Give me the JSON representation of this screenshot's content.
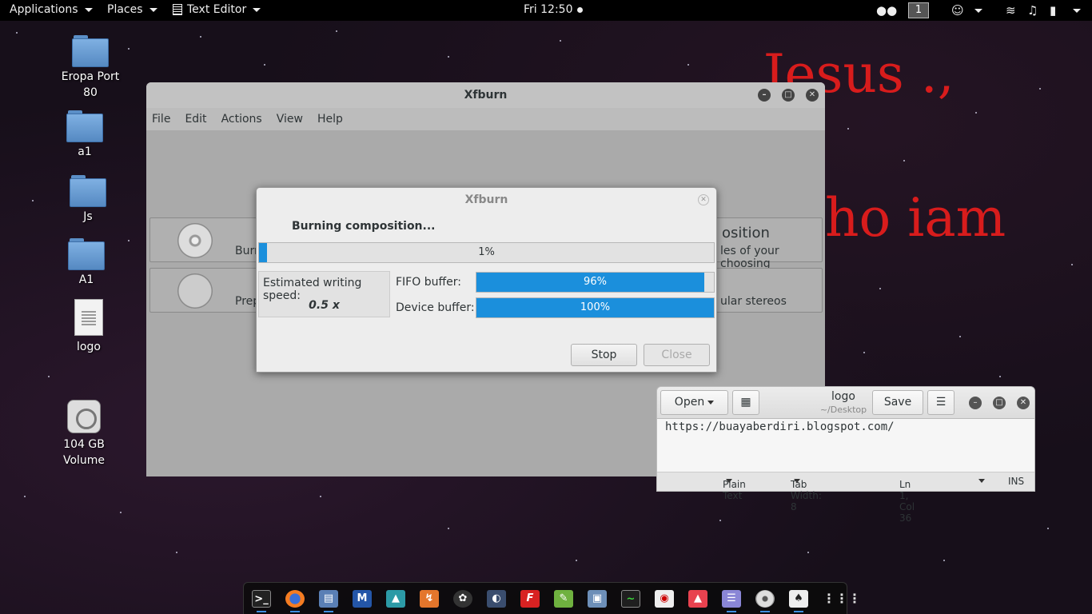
{
  "topbar": {
    "applications": "Applications",
    "places": "Places",
    "app_menu": "Text Editor",
    "clock": "Fri 12:50",
    "workspace": "1"
  },
  "wallpaper": {
    "line1": "Jesus .,",
    "line2": "ho iam"
  },
  "desktop_icons": [
    {
      "label": "Eropa Port 80"
    },
    {
      "label": "a1"
    },
    {
      "label": "Js"
    },
    {
      "label": "A1"
    },
    {
      "label": "logo"
    },
    {
      "label": "104 GB Volume"
    }
  ],
  "xfburn": {
    "title": "Xfburn",
    "menu": [
      "File",
      "Edit",
      "Actions",
      "View",
      "Help"
    ],
    "btn1_left": "Burn",
    "btn1_right_top": "osition",
    "btn1_right_bottom": "les of your choosing",
    "btn2_left": "Prep",
    "btn2_right": "ular stereos"
  },
  "dialog": {
    "title": "Xfburn",
    "status": "Burning composition...",
    "progress": {
      "text": "1%",
      "value": 0.01
    },
    "speed_label": "Estimated writing speed:",
    "speed_value": "0.5 x",
    "fifo_label": "FIFO buffer:",
    "fifo": {
      "text": "96%",
      "value": 0.96
    },
    "device_label": "Device buffer:",
    "device": {
      "text": "100%",
      "value": 1.0
    },
    "stop": "Stop",
    "close": "Close"
  },
  "gedit": {
    "open": "Open",
    "save": "Save",
    "title": "logo",
    "subtitle": "~/Desktop",
    "content": "https://buayaberdiri.blogspot.com/",
    "status_lang": "Plain Text",
    "status_tab": "Tab Width: 8",
    "status_pos": "Ln 1, Col 36",
    "status_mode": "INS"
  },
  "dock": {
    "items": [
      "terminal-icon",
      "firefox-icon",
      "files-icon",
      "metasploit-icon",
      "maltego-icon",
      "burpsuite-icon",
      "armitage-icon",
      "zenmap-icon",
      "faraday-icon",
      "leafpad-icon",
      "virtualbox-icon",
      "system-monitor-icon",
      "ktorrent-icon",
      "image-viewer-icon",
      "text-editor-icon",
      "xfburn-icon",
      "inkscape-icon",
      "show-apps-icon"
    ]
  }
}
